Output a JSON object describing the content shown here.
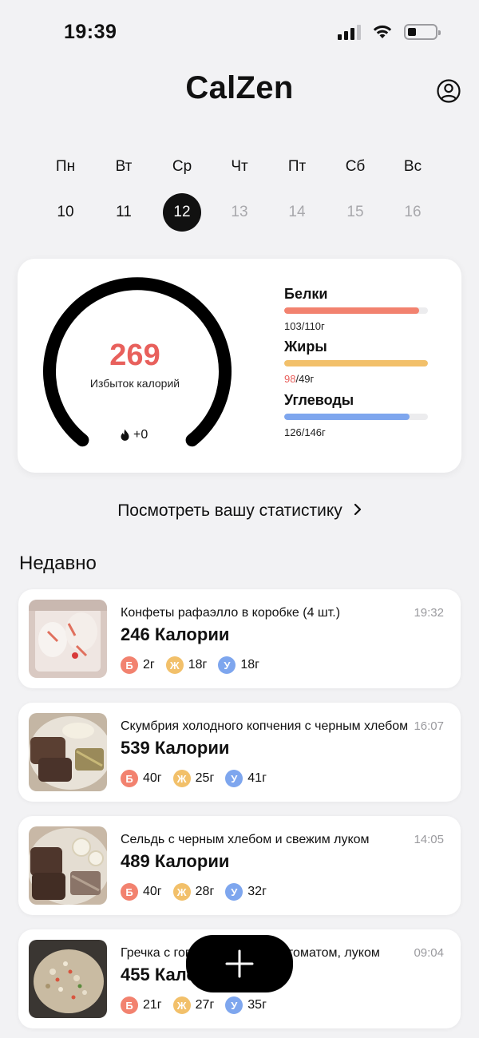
{
  "status_bar": {
    "time": "19:39"
  },
  "header": {
    "title": "CalZen"
  },
  "week": [
    {
      "name": "Пн",
      "num": "10",
      "state": "past"
    },
    {
      "name": "Вт",
      "num": "11",
      "state": "past"
    },
    {
      "name": "Ср",
      "num": "12",
      "state": "selected"
    },
    {
      "name": "Чт",
      "num": "13",
      "state": "future"
    },
    {
      "name": "Пт",
      "num": "14",
      "state": "future"
    },
    {
      "name": "Сб",
      "num": "15",
      "state": "future"
    },
    {
      "name": "Вс",
      "num": "16",
      "state": "future"
    }
  ],
  "summary": {
    "value": "269",
    "caption": "Избыток калорий",
    "burn": "+0",
    "macros": [
      {
        "name": "Белки",
        "eaten": "103",
        "goal": "/110г",
        "progress": 0.94,
        "color": "#f2826f",
        "over": false
      },
      {
        "name": "Жиры",
        "eaten": "98",
        "goal": "/49г",
        "progress": 1.0,
        "color": "#f2c06a",
        "over": true
      },
      {
        "name": "Углеводы",
        "eaten": "126",
        "goal": "/146г",
        "progress": 0.87,
        "color": "#7ea6ee",
        "over": false
      }
    ]
  },
  "stats_link": {
    "label": "Посмотреть вашу статистику"
  },
  "recent": {
    "title": "Недавно",
    "items": [
      {
        "name": "Конфеты рафаэлло в коробке (4 шт.)",
        "time": "19:32",
        "calories": "246 Калории",
        "protein": "2г",
        "fat": "18г",
        "carbs": "18г",
        "photo": "candy"
      },
      {
        "name": "Скумбрия холодного копчения с черным хлебом",
        "time": "16:07",
        "calories": "539 Калории",
        "protein": "40г",
        "fat": "25г",
        "carbs": "41г",
        "photo": "mackerel"
      },
      {
        "name": "Сельдь с черным хлебом и свежим луком",
        "time": "14:05",
        "calories": "489 Калории",
        "protein": "40г",
        "fat": "28г",
        "carbs": "32г",
        "photo": "herring"
      },
      {
        "name": "Гречка с говядиной, сыром, томатом, луком",
        "time": "09:04",
        "calories": "455 Калории",
        "protein": "21г",
        "fat": "27г",
        "carbs": "35г",
        "photo": "buckwheat"
      }
    ]
  },
  "macro_badges": {
    "protein": "Б",
    "fat": "Ж",
    "carbs": "У"
  },
  "colors": {
    "protein": "#f2826f",
    "fat": "#f2c06a",
    "carbs": "#7ea6ee",
    "surplus": "#e8605c",
    "accent": "#111111"
  },
  "icons": {
    "profile": "person-circle-icon",
    "burn": "flame-icon",
    "chevron": "chevron-right-icon",
    "add": "plus-icon"
  }
}
